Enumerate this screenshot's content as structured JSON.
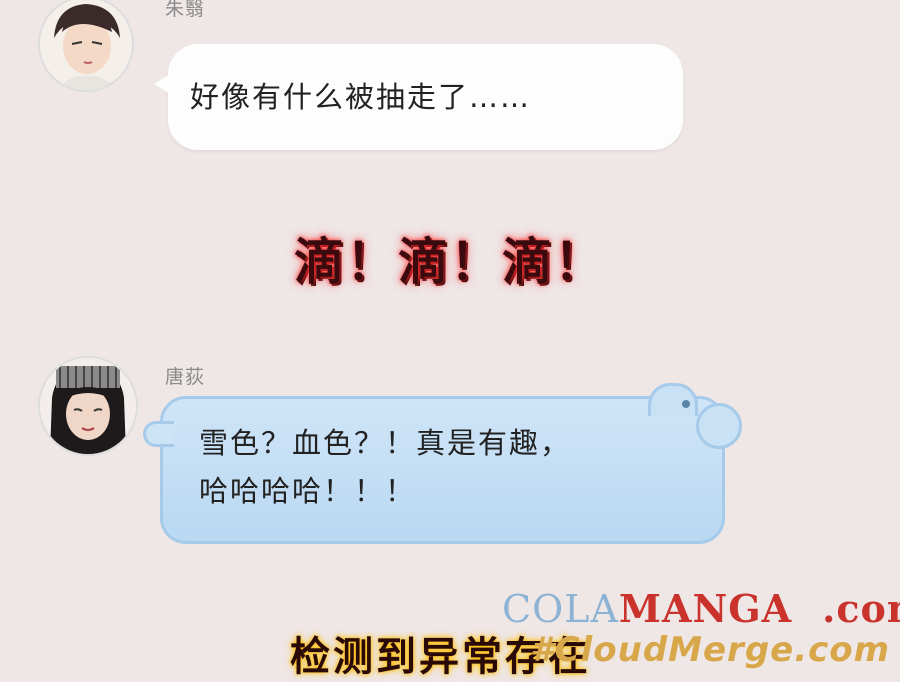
{
  "messages": [
    {
      "sender": "朱翳",
      "text_lines": [
        "好像有什么被抽走了……"
      ],
      "bubble_color": "#fdfdfd"
    },
    {
      "sender": "唐荻",
      "text_lines": [
        "雪色？血色？！真是有趣，",
        "哈哈哈哈！！！"
      ],
      "bubble_color": "#c6e0f5"
    }
  ],
  "sound_effect": "滴！滴！滴！",
  "caption": "检测到异常存在",
  "watermark": {
    "line1_part1": "COLA",
    "line1_part2": "MANGA",
    "line1_part3": ".com",
    "line2": "#CloudMerge.com"
  },
  "colors": {
    "background": "#efe6e6",
    "sfx_glow": "#ff3030",
    "caption_glow": "#ffb800"
  }
}
